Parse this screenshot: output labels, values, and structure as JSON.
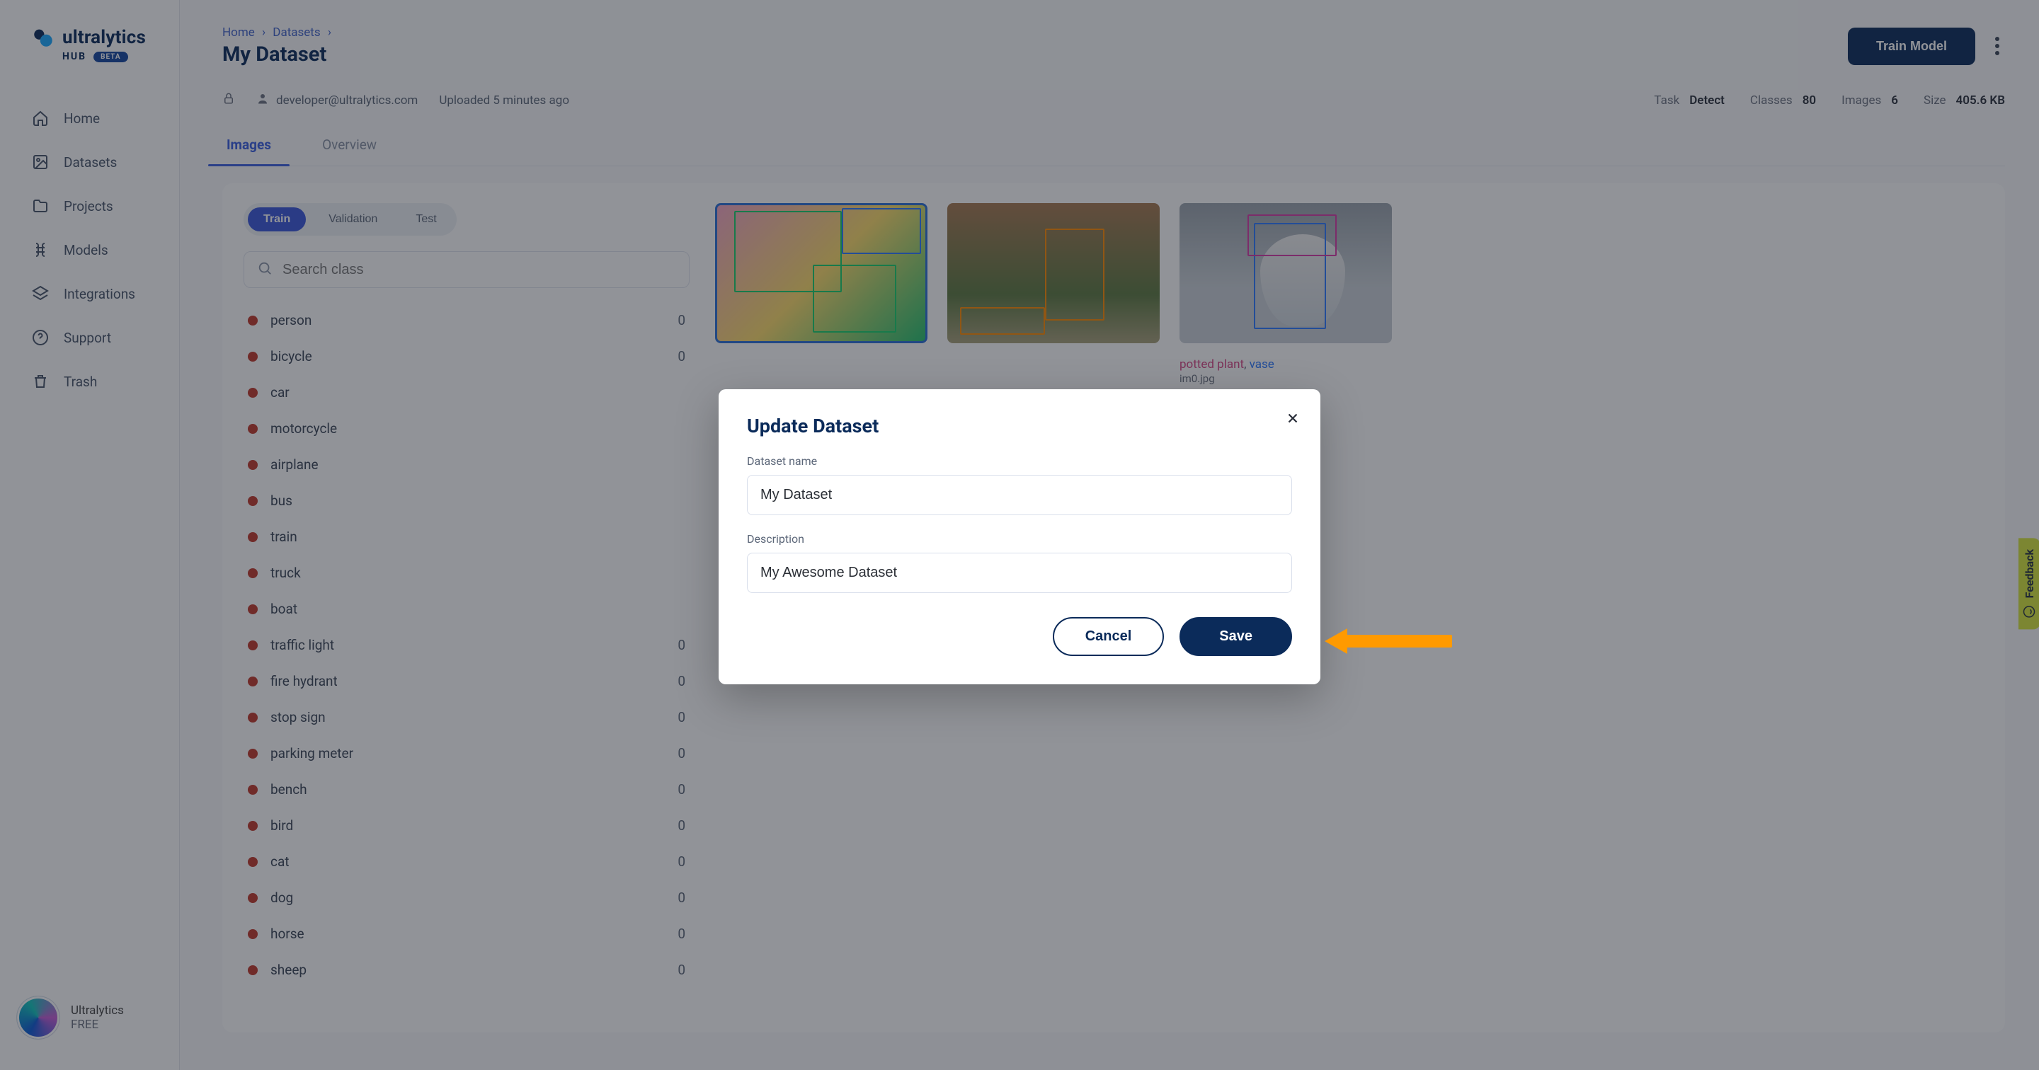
{
  "brand": {
    "name": "ultralytics",
    "hub": "HUB",
    "beta": "BETA"
  },
  "sidebar": {
    "items": [
      {
        "label": "Home"
      },
      {
        "label": "Datasets"
      },
      {
        "label": "Projects"
      },
      {
        "label": "Models"
      },
      {
        "label": "Integrations"
      },
      {
        "label": "Support"
      },
      {
        "label": "Trash"
      }
    ],
    "user": {
      "name": "Ultralytics",
      "plan": "FREE"
    }
  },
  "breadcrumb": {
    "home": "Home",
    "section": "Datasets"
  },
  "page": {
    "title": "My Dataset",
    "owner": "developer@ultralytics.com",
    "uploaded": "Uploaded 5 minutes ago"
  },
  "actions": {
    "train": "Train Model"
  },
  "stats": {
    "task_k": "Task",
    "task_v": "Detect",
    "classes_k": "Classes",
    "classes_v": "80",
    "images_k": "Images",
    "images_v": "6",
    "size_k": "Size",
    "size_v": "405.6 KB"
  },
  "tabs": {
    "images": "Images",
    "overview": "Overview"
  },
  "splits": {
    "train": "Train",
    "val": "Validation",
    "test": "Test"
  },
  "search": {
    "placeholder": "Search class"
  },
  "classes": [
    {
      "name": "person",
      "dot": "#c0392b",
      "count": "0"
    },
    {
      "name": "bicycle",
      "dot": "#c0392b",
      "count": "0"
    },
    {
      "name": "car",
      "dot": "#c0392b",
      "count": ""
    },
    {
      "name": "motorcycle",
      "dot": "#c0392b",
      "count": ""
    },
    {
      "name": "airplane",
      "dot": "#c0392b",
      "count": ""
    },
    {
      "name": "bus",
      "dot": "#c0392b",
      "count": ""
    },
    {
      "name": "train",
      "dot": "#c0392b",
      "count": ""
    },
    {
      "name": "truck",
      "dot": "#c0392b",
      "count": ""
    },
    {
      "name": "boat",
      "dot": "#c0392b",
      "count": ""
    },
    {
      "name": "traffic light",
      "dot": "#c0392b",
      "count": "0"
    },
    {
      "name": "fire hydrant",
      "dot": "#c0392b",
      "count": "0"
    },
    {
      "name": "stop sign",
      "dot": "#c0392b",
      "count": "0"
    },
    {
      "name": "parking meter",
      "dot": "#c0392b",
      "count": "0"
    },
    {
      "name": "bench",
      "dot": "#c0392b",
      "count": "0"
    },
    {
      "name": "bird",
      "dot": "#c0392b",
      "count": "0"
    },
    {
      "name": "cat",
      "dot": "#c0392b",
      "count": "0"
    },
    {
      "name": "dog",
      "dot": "#c0392b",
      "count": "0"
    },
    {
      "name": "horse",
      "dot": "#c0392b",
      "count": "0"
    },
    {
      "name": "sheep",
      "dot": "#c0392b",
      "count": "0"
    }
  ],
  "thumbs": {
    "caption_tag1": "potted plant",
    "caption_tag2": "vase",
    "caption_fn": "im0.jpg"
  },
  "dialog": {
    "title": "Update Dataset",
    "name_label": "Dataset name",
    "name_value": "My Dataset",
    "desc_label": "Description",
    "desc_value": "My Awesome Dataset",
    "cancel": "Cancel",
    "save": "Save"
  },
  "feedback": {
    "label": "Feedback"
  }
}
